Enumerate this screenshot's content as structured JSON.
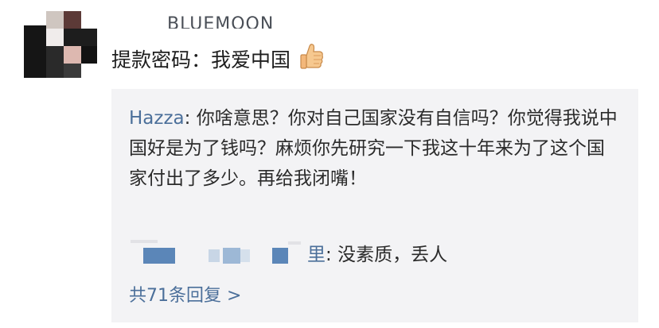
{
  "post": {
    "username": "BLUEMOON",
    "comment_text": "提款密码：我爱中国"
  },
  "reply": {
    "author": "Hazza",
    "separator": ": ",
    "text": "你啥意思？你对自己国家没有自信吗？你觉得我说中国好是为了钱吗？麻烦你先研究一下我这十年来为了这个国家付出了多少。再给我闭嘴！"
  },
  "sub_reply": {
    "author_tail": "里",
    "separator": ": ",
    "text": "没素质，丢人"
  },
  "more_replies_label": "共71条回复 >",
  "colors": {
    "link_blue": "#4b6f9a",
    "reply_bg": "#f3f3f5",
    "pixel_blue": "#5b86b8",
    "pixel_light": "#9db8d6"
  },
  "icons": {
    "thumbs_up": "thumbs-up-icon",
    "avatar": "avatar"
  }
}
